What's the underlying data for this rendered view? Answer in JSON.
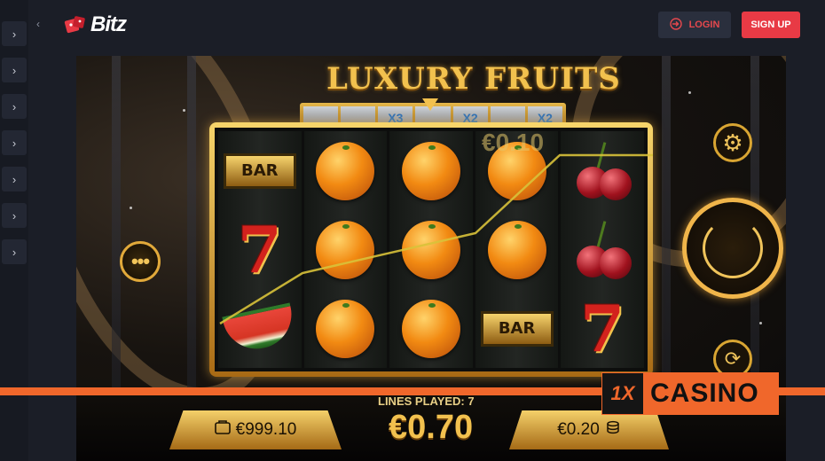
{
  "header": {
    "brand": "Bitz",
    "login_label": "LOGIN",
    "signup_label": "SIGN UP"
  },
  "sidebar": {
    "items": [
      {
        "icon": "chevron-right-icon",
        "glyph": "›"
      },
      {
        "icon": "chevron-right-icon",
        "glyph": "›"
      },
      {
        "icon": "chevron-right-icon",
        "glyph": "›"
      },
      {
        "icon": "chevron-right-icon",
        "glyph": "›"
      },
      {
        "icon": "chevron-right-icon",
        "glyph": "›"
      },
      {
        "icon": "chevron-right-icon",
        "glyph": "›"
      },
      {
        "icon": "chevron-right-icon",
        "glyph": "›"
      }
    ],
    "collapse_glyph": "‹"
  },
  "game": {
    "title": "LUXURY FRUITS",
    "multipliers": [
      "",
      "",
      "X3",
      "",
      "X2",
      "",
      "X2"
    ],
    "win_amount": "€0.10",
    "lines_played_label": "LINES PLAYED: 7",
    "total_bet": "€0.70",
    "balance": "€999.10",
    "bet_per_line": "€0.20",
    "menu_glyph": "•••",
    "gear_glyph": "⚙",
    "autoplay_glyph": "⟳",
    "reels": [
      [
        "bar",
        "seven",
        "melon"
      ],
      [
        "orange",
        "orange",
        "orange"
      ],
      [
        "orange",
        "orange",
        "orange"
      ],
      [
        "orange",
        "orange",
        "bar"
      ],
      [
        "cherry",
        "cherry",
        "seven"
      ]
    ],
    "bar_text": "BAR",
    "seven_text": "7"
  },
  "watermark": {
    "mark": "1X",
    "text": "CASINO"
  },
  "colors": {
    "accent_red": "#e83a45",
    "gold": "#f2c14e",
    "watermark_orange": "#f0672b"
  }
}
